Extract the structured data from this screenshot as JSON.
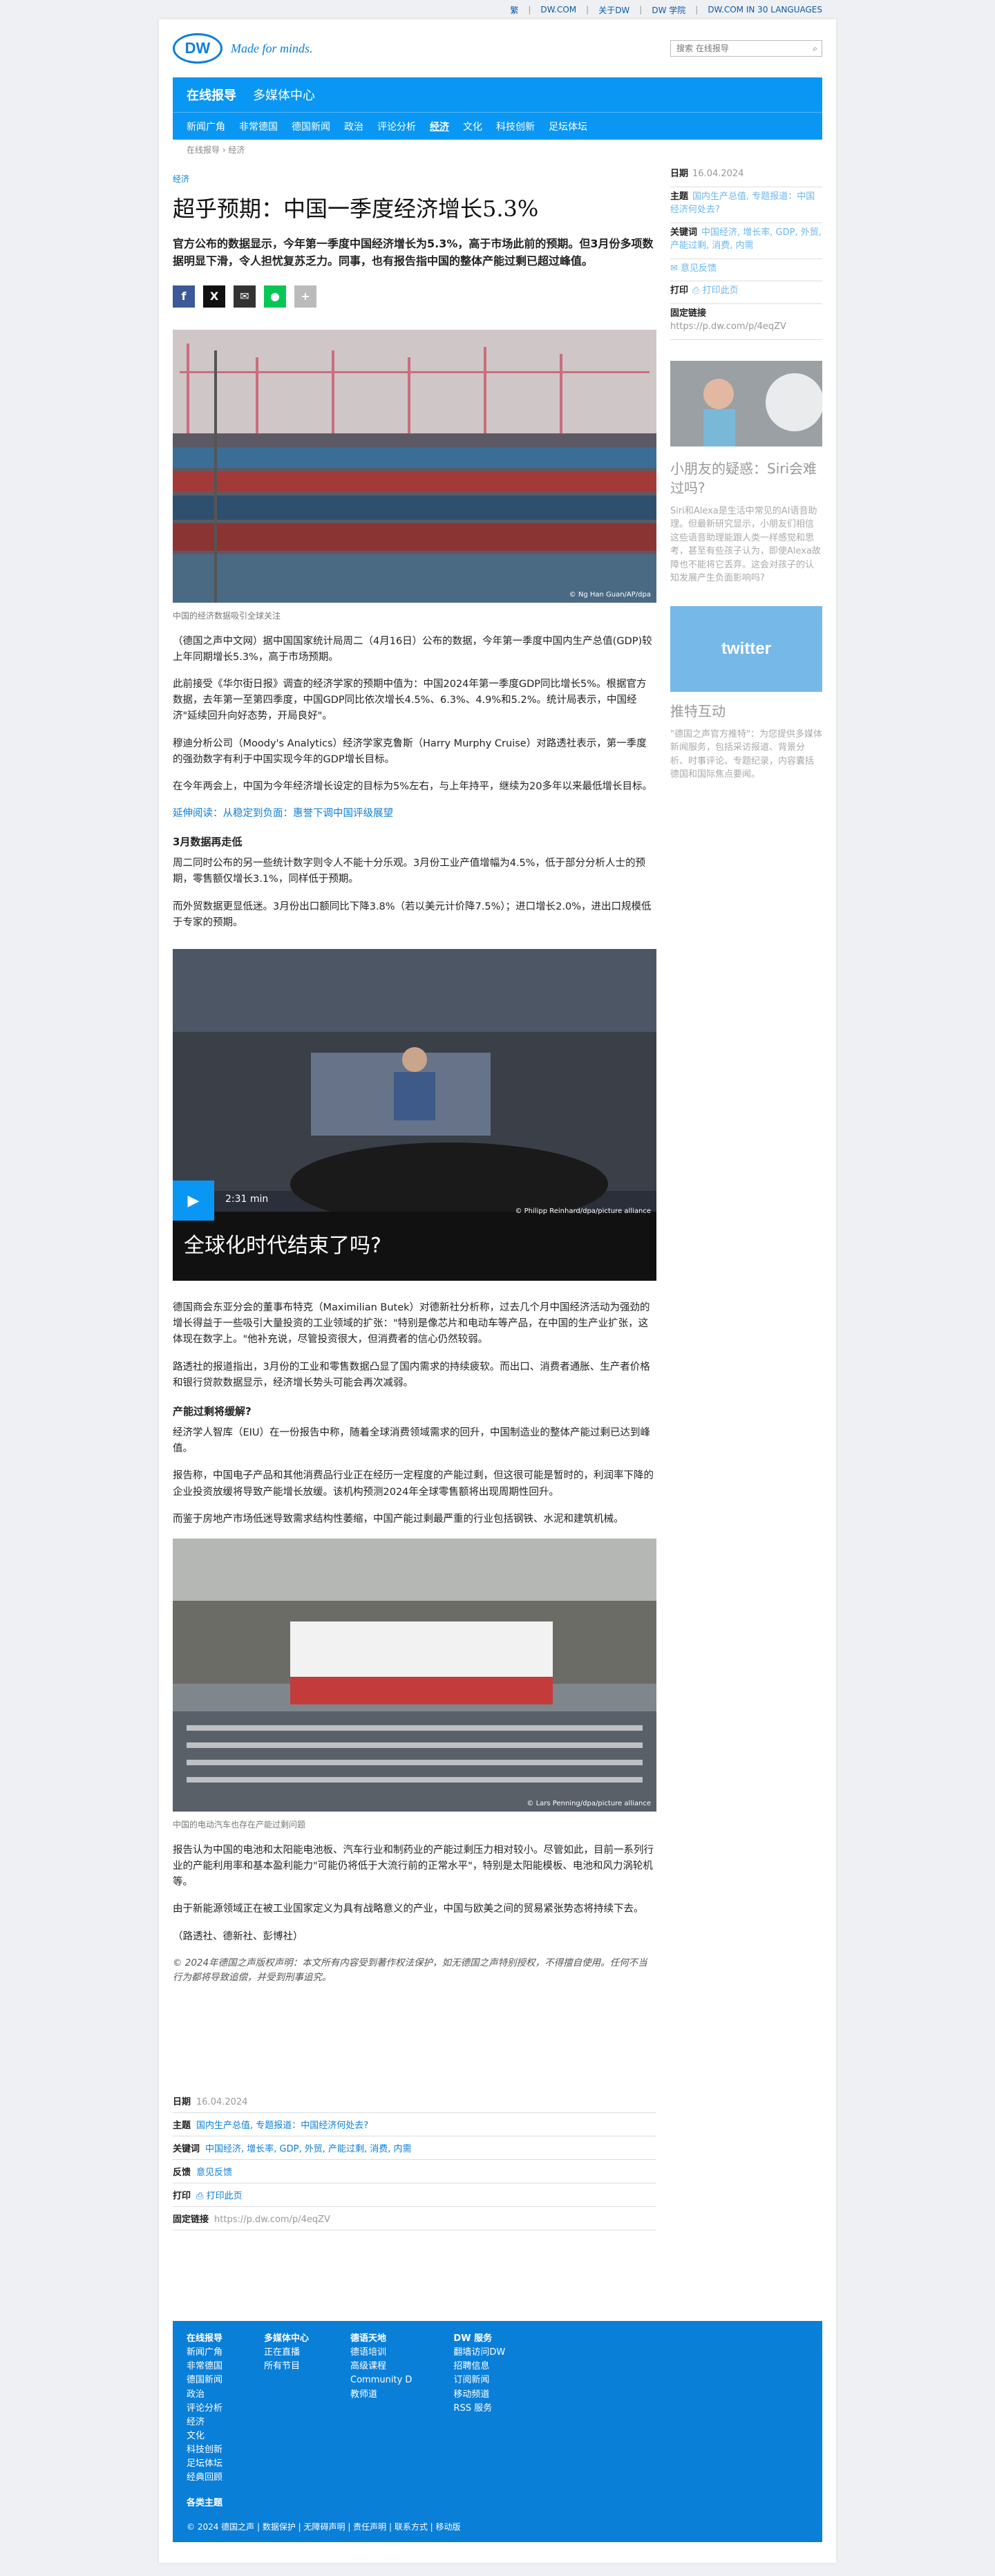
{
  "topbar": {
    "links": [
      "繁",
      "DW.COM",
      "关于DW",
      "DW 学院",
      "DW.COM IN 30 LANGUAGES"
    ]
  },
  "brand": {
    "logo": "DW",
    "tagline": "Made for minds."
  },
  "search": {
    "placeholder": "搜索 在线报导"
  },
  "nav": {
    "primary": [
      "在线报导",
      "多媒体中心"
    ],
    "secondary": [
      "新闻广角",
      "非常德国",
      "德国新闻",
      "政治",
      "评论分析",
      "经济",
      "文化",
      "科技创新",
      "足坛体坛"
    ],
    "current": "经济"
  },
  "breadcrumb": "在线报导 › 经济",
  "article": {
    "kicker": "经济",
    "title": "超乎预期：中国一季度经济增长5.3%",
    "lead": "官方公布的数据显示，今年第一季度中国经济增长为5.3%，高于市场此前的预期。但3月份多项数据明显下滑，令人担忧复苏乏力。同事，也有报告指中国的整体产能过剩已超过峰值。",
    "image1_caption": "中国的经济数据吸引全球关注",
    "image1_credit": "© Ng Han Guan/AP/dpa",
    "paragraphs1": [
      "（德国之声中文网）据中国国家统计局周二（4月16日）公布的数据，今年第一季度中国内生产总值(GDP)较上年同期增长5.3%，高于市场预期。",
      "此前接受《华尔街日报》调查的经济学家的预期中值为：中国2024年第一季度GDP同比增长5%。根据官方数据，去年第一至第四季度，中国GDP同比依次增长4.5%、6.3%、4.9%和5.2%。统计局表示，中国经济\"延续回升向好态势，开局良好\"。",
      "穆迪分析公司（Moody's Analytics）经济学家克鲁斯（Harry Murphy Cruise）对路透社表示，第一季度的强劲数字有利于中国实现今年的GDP增长目标。",
      "在今年两会上，中国为今年经济增长设定的目标为5%左右，与上年持平，继续为20多年以来最低增长目标。",
      "延伸阅读：从稳定到负面：惠誉下调中国评级展望"
    ],
    "heading1": "3月数据再走低",
    "paragraphs2": [
      "周二同时公布的另一些统计数字则令人不能十分乐观。3月份工业产值增幅为4.5%，低于部分分析人士的预期，零售额仅增长3.1%，同样低于预期。",
      "而外贸数据更显低迷。3月份出口额同比下降3.8%（若以美元计价降7.5%）；进口增长2.0%，进出口规模低于专家的预期。"
    ],
    "video": {
      "duration": "2:31 min",
      "title": "全球化时代结束了吗?",
      "credit": "© Philipp Reinhard/dpa/picture alliance"
    },
    "paragraphs3": [
      "德国商会东亚分会的董事布特克（Maximilian Butek）对德新社分析称，过去几个月中国经济活动为强劲的增长得益于一些吸引大量投资的工业领域的扩张：\"特别是像芯片和电动车等产品，在中国的生产业扩张，这体现在数字上。\"他补充说，尽管投资很大，但消费者的信心仍然较弱。",
      "路透社的报道指出，3月份的工业和零售数据凸显了国内需求的持续疲软。而出口、消费者通胀、生产者价格和银行贷款数据显示，经济增长势头可能会再次减弱。"
    ],
    "heading2": "产能过剩将缓解?",
    "paragraphs4": [
      "经济学人智库（EIU）在一份报告中称，随着全球消费领域需求的回升，中国制造业的整体产能过剩已达到峰值。",
      "报告称，中国电子产品和其他消费品行业正在经历一定程度的产能过剩，但这很可能是暂时的，利润率下降的企业投资放缓将导致产能增长放缓。该机构预测2024年全球零售额将出现周期性回升。",
      "而鉴于房地产市场低迷导致需求结构性萎缩，中国产能过剩最严重的行业包括钢铁、水泥和建筑机械。"
    ],
    "image2_caption": "中国的电动汽车也存在产能过剩问题",
    "image2_credit": "© Lars Penning/dpa/picture alliance",
    "paragraphs5": [
      "报告认为中国的电池和太阳能电池板、汽车行业和制药业的产能过剩压力相对较小。尽管如此，目前一系列行业的产能利用率和基本盈利能力\"可能仍将低于大流行前的正常水平\"，特别是太阳能模板、电池和风力涡轮机等。",
      "由于新能源领域正在被工业国家定义为具有战略意义的产业，中国与欧美之间的贸易紧张势态将持续下去。",
      "（路透社、德新社、彭博社）"
    ],
    "copyright": "© 2024年德国之声版权声明：本文所有内容受到著作权法保护，如无德国之声特别授权，不得擅自使用。任何不当行为都将导致追偿，并受到刑事追究。"
  },
  "meta": {
    "date_label": "日期",
    "date": "16.04.2024",
    "topic_label": "主题",
    "topic": "国内生产总值, 专题报道：中国经济何处去?",
    "keywords_label": "关键词",
    "keywords": "中国经济, 增长率, GDP, 外贸, 产能过剩, 消费, 内需",
    "feedback_label": "反馈",
    "feedback": "意见反馈",
    "print_label": "打印",
    "print": "打印此页",
    "permalink_label": "固定链接",
    "permalink": "https://p.dw.com/p/4eqZV"
  },
  "sidebar": {
    "teaser1": {
      "title": "小朋友的疑惑：Siri会难过吗?",
      "text": "Siri和Alexa是生活中常见的AI语音助理。但最新研究显示，小朋友们相信这些语音助理能跟人类一样感觉和思考，甚至有些孩子认为，即使Alexa故障也不能将它丢弃。这会对孩子的认知发展产生负面影响吗?"
    },
    "teaser2": {
      "logo": "twitter",
      "title": "推特互动",
      "text": "\"德国之声官方推特\"：为您提供多媒体新闻服务，包括采访报道、背景分析、时事评论、专题纪录，内容囊括德国和国际焦点要闻。"
    }
  },
  "footer": {
    "cols": [
      {
        "title": "在线报导",
        "items": [
          "新闻广角",
          "非常德国",
          "德国新闻",
          "政治",
          "评论分析",
          "经济",
          "文化",
          "科技创新",
          "足坛体坛",
          "经典回顾"
        ]
      },
      {
        "title": "多媒体中心",
        "items": [
          "正在直播",
          "所有节目"
        ]
      },
      {
        "title": "德语天地",
        "items": [
          "德语培训",
          "高级课程",
          "Community D",
          "教师道"
        ]
      },
      {
        "title": "DW 服务",
        "items": [
          "翻墙访问DW",
          "招聘信息",
          "订阅新闻",
          "移动频道",
          "RSS 服务"
        ]
      }
    ],
    "topics": "各类主题",
    "bottom": "© 2024 德国之声 | 数据保护 | 无障碍声明 | 责任声明 | 联系方式 | 移动版"
  },
  "colors": {
    "accent": "#0a97f4",
    "link": "#0c7fd8"
  }
}
